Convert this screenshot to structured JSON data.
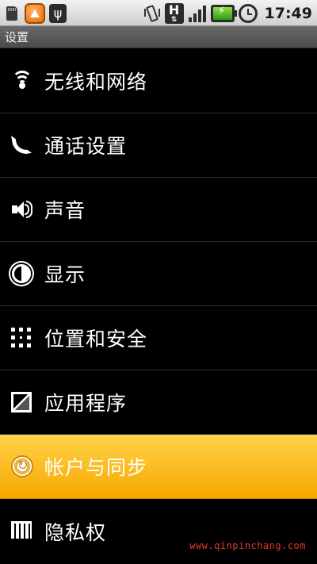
{
  "status_bar": {
    "time": "17:49",
    "icons": [
      "sd-card-icon",
      "warning-icon",
      "usb-icon",
      "vibrate-icon",
      "hsdpa-icon",
      "signal-icon",
      "battery-charging-icon",
      "alarm-icon"
    ],
    "signal_bars": 4
  },
  "title_bar": {
    "title": "设置"
  },
  "settings": {
    "items": [
      {
        "label": "无线和网络",
        "icon": "wifi-icon",
        "selected": false
      },
      {
        "label": "通话设置",
        "icon": "phone-icon",
        "selected": false
      },
      {
        "label": "声音",
        "icon": "speaker-icon",
        "selected": false
      },
      {
        "label": "显示",
        "icon": "brightness-icon",
        "selected": false
      },
      {
        "label": "位置和安全",
        "icon": "location-grid-icon",
        "selected": false
      },
      {
        "label": "应用程序",
        "icon": "applications-icon",
        "selected": false
      },
      {
        "label": "帐户与同步",
        "icon": "sync-icon",
        "selected": true
      },
      {
        "label": "隐私权",
        "icon": "privacy-icon",
        "selected": false
      }
    ]
  },
  "colors": {
    "selected_start": "#ffd24a",
    "selected_end": "#f7a800",
    "watermark": "#e23a2a"
  },
  "watermark": "www.qinpinchang.com"
}
